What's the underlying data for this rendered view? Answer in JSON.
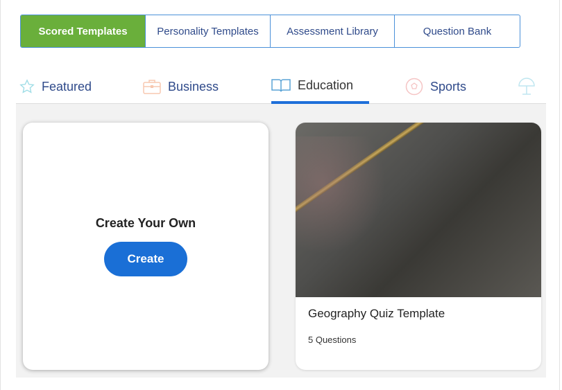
{
  "top_tabs": [
    "Scored Templates",
    "Personality Templates",
    "Assessment Library",
    "Question Bank"
  ],
  "category_tabs": [
    {
      "label": "Featured",
      "icon": "star-icon"
    },
    {
      "label": "Business",
      "icon": "briefcase-icon"
    },
    {
      "label": "Education",
      "icon": "book-icon",
      "active": true
    },
    {
      "label": "Sports",
      "icon": "soccer-ball-icon"
    },
    {
      "label": "",
      "icon": "beach-umbrella-icon"
    }
  ],
  "create_card": {
    "title": "Create Your Own",
    "button": "Create"
  },
  "template_card": {
    "title": "Geography Quiz Template",
    "subtitle": "5 Questions"
  },
  "colors": {
    "accent": "#1a6fd6",
    "active_segment": "#6aaf3b"
  }
}
